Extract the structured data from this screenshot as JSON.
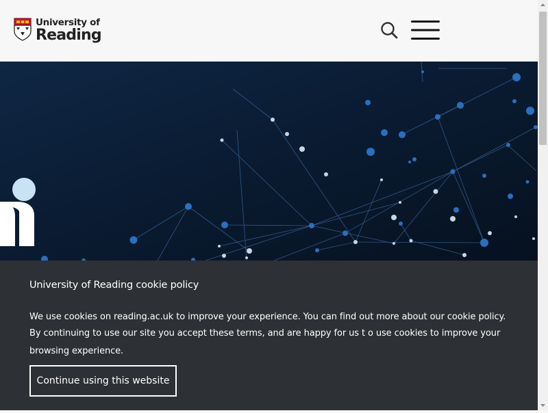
{
  "header": {
    "logo": {
      "line1": "University of",
      "line2": "Reading",
      "icon": "university-crest-icon"
    },
    "search_icon": "search-icon",
    "menu_icon": "hamburger-menu-icon"
  },
  "hero": {
    "background_colors": [
      "#0f2744",
      "#06111f"
    ],
    "graphic": "network-nodes-graphic"
  },
  "cookie_banner": {
    "title": "University of Reading cookie policy",
    "paragraph1": "We use cookies on reading.ac.uk to improve your experience. You can find out more about our cookie policy.",
    "paragraph2": "By continuing to use our site you accept these terms, and are happy for us t o use cookies to improve your browsing experience.",
    "button_label": "Continue using this website",
    "background_color": "#2d3034"
  },
  "colors": {
    "header_bg": "#f7f7f7",
    "text_dark": "#222222",
    "crest_red": "#c8102e",
    "node_blue": "#2a6fc0",
    "node_light": "#c8d6e4"
  }
}
